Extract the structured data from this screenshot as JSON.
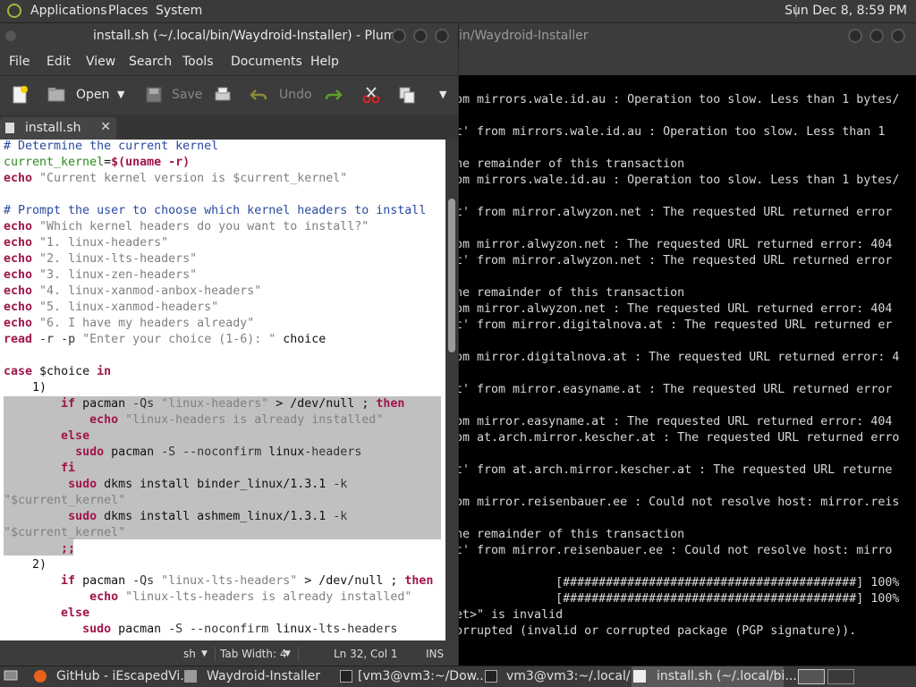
{
  "top_panel": {
    "menus": [
      "Applications",
      "Places",
      "System"
    ],
    "clock": "Sun Dec  8,  8:59 PM"
  },
  "editor_window": {
    "title": "install.sh (~/.local/bin/Waydroid-Installer) - Pluma",
    "menu": [
      "File",
      "Edit",
      "View",
      "Search",
      "Tools",
      "Documents",
      "Help"
    ],
    "toolbar": {
      "open_label": "Open",
      "save_label": "Save",
      "undo_label": "Undo"
    },
    "tab_label": "install.sh",
    "code_lines": [
      "# Determine the current kernel",
      "current_kernel=$(uname -r)",
      "echo \"Current kernel version is $current_kernel\"",
      "",
      "# Prompt the user to choose which kernel headers to install",
      "echo \"Which kernel headers do you want to install?\"",
      "echo \"1. linux-headers\"",
      "echo \"2. linux-lts-headers\"",
      "echo \"3. linux-zen-headers\"",
      "echo \"4. linux-xanmod-anbox-headers\"",
      "echo \"5. linux-xanmod-headers\"",
      "echo \"6. I have my headers already\"",
      "read -r -p \"Enter your choice (1-6): \" choice",
      "",
      "case $choice in",
      "    1)",
      "        if pacman -Qs \"linux-headers\" > /dev/null ; then",
      "            echo \"linux-headers is already installed\"",
      "        else",
      "          sudo pacman -S --noconfirm linux-headers",
      "        fi",
      "         sudo dkms install binder_linux/1.3.1 -k",
      "\"$current_kernel\"",
      "         sudo dkms install ashmem_linux/1.3.1 -k",
      "\"$current_kernel\"",
      "        ;;",
      "    2)",
      "        if pacman -Qs \"linux-lts-headers\" > /dev/null ; then",
      "            echo \"linux-lts-headers is already installed\"",
      "        else",
      "           sudo pacman -S --noconfirm linux-lts-headers"
    ],
    "status": {
      "language": "sh",
      "tab_width": "Tab Width:  4",
      "position": "Ln 32, Col 1",
      "mode": "INS"
    }
  },
  "terminal_window": {
    "title": "in/Waydroid-Installer",
    "lines": [
      "om mirrors.wale.id.au : Operation too slow. Less than 1 bytes/",
      "",
      "t' from mirrors.wale.id.au : Operation too slow. Less than 1",
      "",
      "he remainder of this transaction",
      "om mirrors.wale.id.au : Operation too slow. Less than 1 bytes/",
      "",
      "t' from mirror.alwyzon.net : The requested URL returned error",
      "",
      "om mirror.alwyzon.net : The requested URL returned error: 404",
      "t' from mirror.alwyzon.net : The requested URL returned error",
      "",
      "he remainder of this transaction",
      "om mirror.alwyzon.net : The requested URL returned error: 404",
      "t' from mirror.digitalnova.at : The requested URL returned er",
      "",
      "om mirror.digitalnova.at : The requested URL returned error: 4",
      "",
      "t' from mirror.easyname.at : The requested URL returned error",
      "",
      "om mirror.easyname.at : The requested URL returned error: 404",
      "om at.arch.mirror.kescher.at : The requested URL returned erro",
      "",
      "t' from at.arch.mirror.kescher.at : The requested URL returne",
      "",
      "om mirror.reisenbauer.ee : Could not resolve host: mirror.reis",
      "",
      "he remainder of this transaction",
      "t' from mirror.reisenbauer.ee : Could not resolve host: mirro",
      "",
      "              [#########################################] 100%",
      "              [#########################################] 100%",
      "et>\" is invalid",
      "orrupted (invalid or corrupted package (PGP signature))."
    ]
  },
  "taskbar": {
    "tasks": [
      "GitHub - iEscapedVi...",
      "Waydroid-Installer",
      "[vm3@vm3:~/Dow...",
      "vm3@vm3:~/.local/...",
      "install.sh (~/.local/bi..."
    ]
  }
}
